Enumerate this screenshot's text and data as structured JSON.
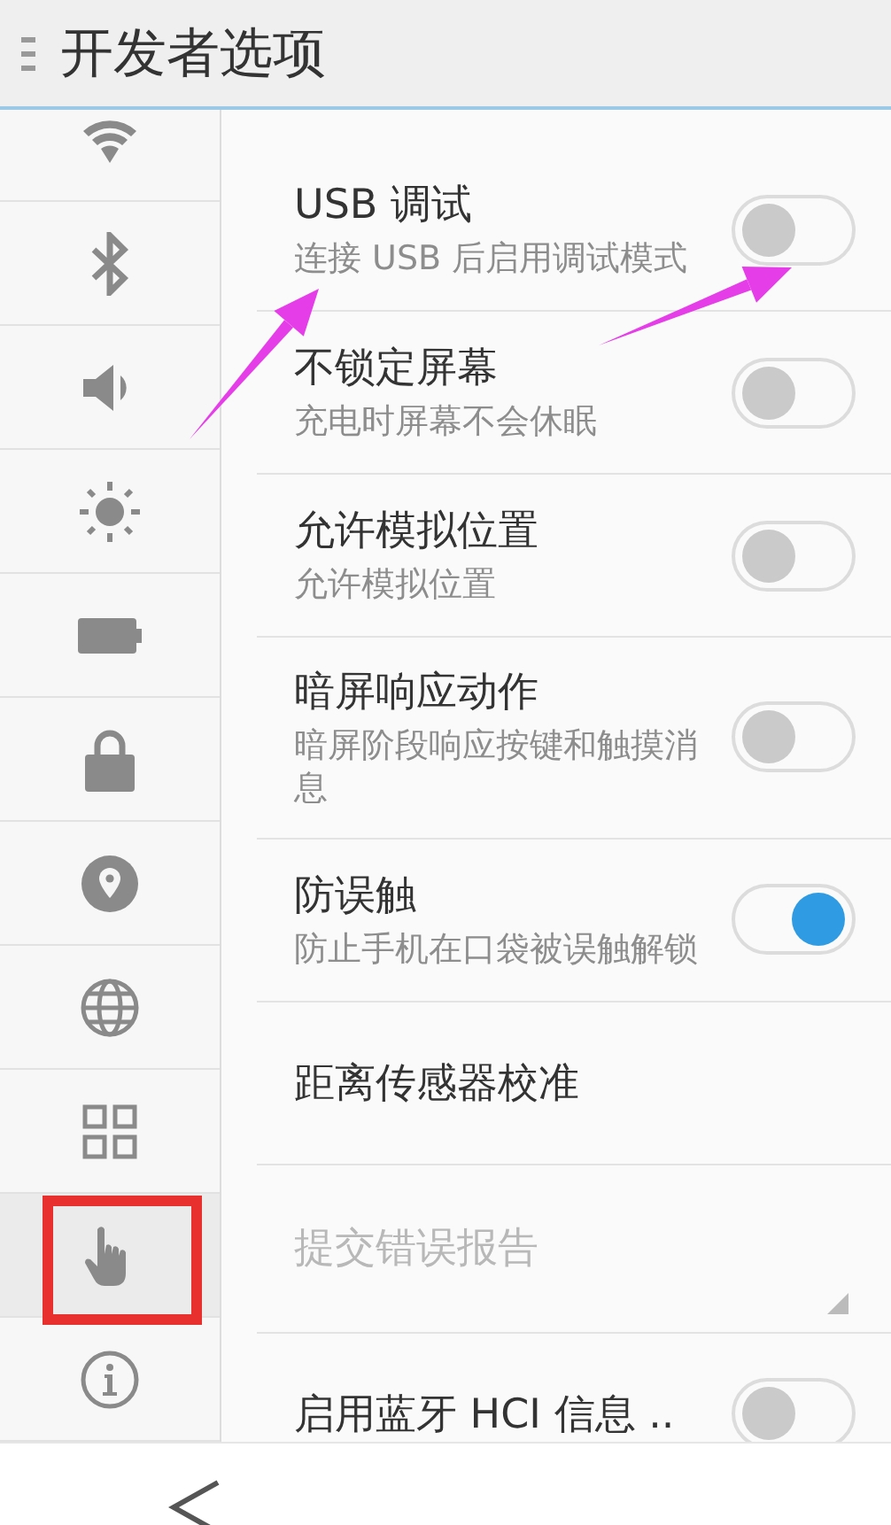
{
  "header": {
    "title": "开发者选项"
  },
  "sidebar": {
    "items": [
      {
        "kind": "wifi",
        "selected": false
      },
      {
        "kind": "bluetooth",
        "selected": false
      },
      {
        "kind": "sound",
        "selected": false
      },
      {
        "kind": "brightness",
        "selected": false
      },
      {
        "kind": "battery",
        "selected": false
      },
      {
        "kind": "lock",
        "selected": false
      },
      {
        "kind": "location",
        "selected": false
      },
      {
        "kind": "globe",
        "selected": false
      },
      {
        "kind": "apps",
        "selected": false
      },
      {
        "kind": "gesture",
        "selected": true
      },
      {
        "kind": "info",
        "selected": false
      }
    ]
  },
  "settings": [
    {
      "kind": "toggle",
      "title": "USB 调试",
      "subtitle": "连接 USB 后启用调试模式",
      "on": false,
      "disabled": false
    },
    {
      "kind": "toggle",
      "title": "不锁定屏幕",
      "subtitle": "充电时屏幕不会休眠",
      "on": false,
      "disabled": false
    },
    {
      "kind": "toggle",
      "title": "允许模拟位置",
      "subtitle": "允许模拟位置",
      "on": false,
      "disabled": false
    },
    {
      "kind": "toggle",
      "title": "暗屏响应动作",
      "subtitle": "暗屏阶段响应按键和触摸消息",
      "on": false,
      "disabled": false
    },
    {
      "kind": "toggle",
      "title": "防误触",
      "subtitle": "防止手机在口袋被误触解锁",
      "on": true,
      "disabled": false
    },
    {
      "kind": "action",
      "title": "距离传感器校准",
      "disabled": false
    },
    {
      "kind": "menu",
      "title": "提交错误报告",
      "disabled": true
    },
    {
      "kind": "toggle",
      "title": "启用蓝牙 HCI 信息 ..",
      "on": false,
      "disabled": false
    }
  ],
  "annotations": [
    {
      "kind": "arrow"
    },
    {
      "kind": "arrow"
    },
    {
      "kind": "box"
    }
  ]
}
